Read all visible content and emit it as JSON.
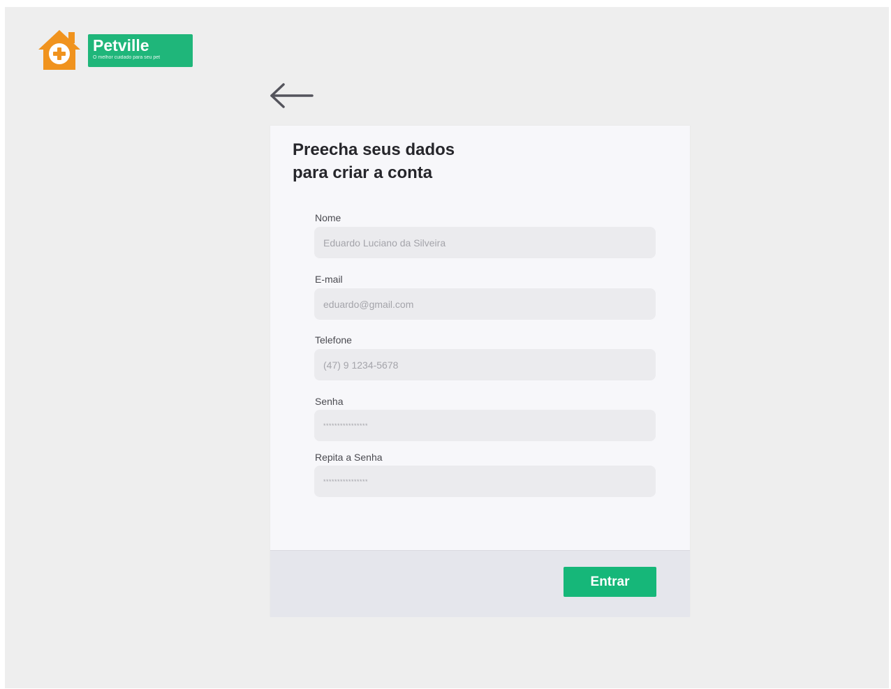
{
  "brand": {
    "name": "Petville",
    "tagline": "O melhor cuidado para seu pet",
    "icon": "house-plus-icon",
    "colors": {
      "house": "#f0931e",
      "badge": "#1fb67a"
    }
  },
  "nav": {
    "back_icon": "arrow-left-icon"
  },
  "form": {
    "title_line1": "Preecha seus dados",
    "title_line2": "para criar a conta",
    "fields": [
      {
        "label": "Nome",
        "placeholder": "Eduardo Luciano da Silveira"
      },
      {
        "label": "E-mail",
        "placeholder": "eduardo@gmail.com"
      },
      {
        "label": "Telefone",
        "placeholder": "(47) 9 1234-5678"
      },
      {
        "label": "Senha",
        "placeholder": "****************"
      },
      {
        "label": "Repita a Senha",
        "placeholder": "****************"
      }
    ],
    "submit_label": "Entrar",
    "colors": {
      "accent": "#16b779"
    }
  }
}
